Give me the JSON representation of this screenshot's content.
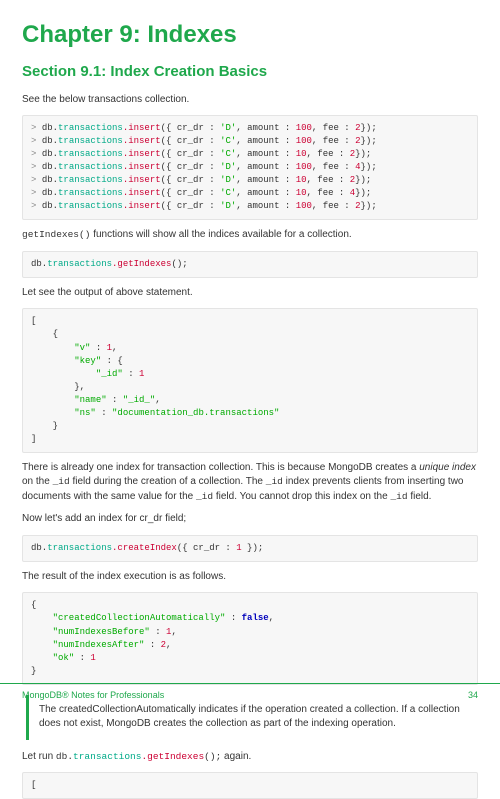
{
  "chapter_title": "Chapter 9: Indexes",
  "section_title": "Section 9.1: Index Creation Basics",
  "intro": "See the below transactions collection.",
  "inserts": [
    {
      "cr_dr": "D",
      "amount": 100,
      "fee": 2
    },
    {
      "cr_dr": "C",
      "amount": 100,
      "fee": 2
    },
    {
      "cr_dr": "C",
      "amount": 10,
      "fee": 2
    },
    {
      "cr_dr": "D",
      "amount": 100,
      "fee": 4
    },
    {
      "cr_dr": "D",
      "amount": 10,
      "fee": 2
    },
    {
      "cr_dr": "C",
      "amount": 10,
      "fee": 4
    },
    {
      "cr_dr": "D",
      "amount": 100,
      "fee": 2
    }
  ],
  "p_getindexes_before": "getIndexes()",
  "p_getindexes_after": " functions will show all the indices available for a collection.",
  "code_getindexes": "db.transactions.getIndexes();",
  "p_output_prompt": "Let see the output of above statement.",
  "getindexes_output": {
    "v": 1,
    "key_label": "\"key\"",
    "key_field_label": "\"_id\"",
    "key_field_value": 1,
    "name_label": "\"name\"",
    "name_value": "\"_id_\"",
    "ns_label": "\"ns\"",
    "ns_value": "\"documentation_db.transactions\""
  },
  "p_unique_1": "There is already one index for transaction collection. This is because MongoDB creates a ",
  "p_unique_em": "unique index",
  "p_unique_2": " on the ",
  "p_unique_code1": "_id",
  "p_unique_3": " field during the creation of a collection. The ",
  "p_unique_code2": "_id",
  "p_unique_4": " index prevents clients from inserting two documents with the same value for the ",
  "p_unique_code3": "_id",
  "p_unique_5": " field. You cannot drop this index on the ",
  "p_unique_code4": "_id",
  "p_unique_6": " field.",
  "p_addindex": "Now let's add an index for cr_dr field;",
  "code_createindex": "db.transactions.createIndex({ cr_dr : 1 });",
  "p_result_intro": "The result of the index execution is as follows.",
  "create_result": {
    "createdCollectionAutomatically_label": "\"createdCollectionAutomatically\"",
    "createdCollectionAutomatically_value": "false",
    "numIndexesBefore_label": "\"numIndexesBefore\"",
    "numIndexesBefore_value": 1,
    "numIndexesAfter_label": "\"numIndexesAfter\"",
    "numIndexesAfter_value": 2,
    "ok_label": "\"ok\"",
    "ok_value": 1
  },
  "callout": "The createdCollectionAutomatically indicates if the operation created a collection. If a collection does not exist, MongoDB creates the collection as part of the indexing operation.",
  "p_rerun_1": "Let run ",
  "p_rerun_code": "db.transactions.getIndexes();",
  "p_rerun_2": " again.",
  "final_bracket": "[",
  "footer_text": "MongoDB® Notes for Professionals",
  "page_number": "34",
  "syntax": {
    "insert_prefix": "> db.",
    "path": "transactions",
    "insert_fn": ".insert",
    "getindexes_fn": ".getIndexes",
    "createindex_fn": ".createIndex",
    "open": "({ cr_dr : ",
    "mid1": ", amount : ",
    "mid2": ", fee : ",
    "close": "});"
  }
}
